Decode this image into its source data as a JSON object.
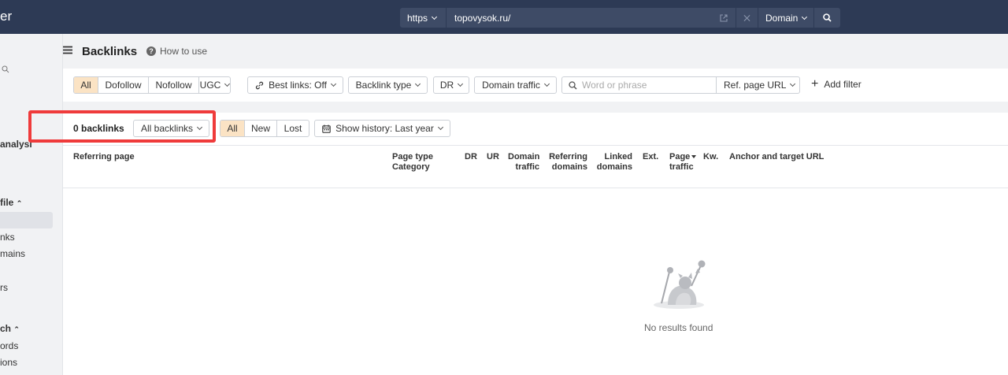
{
  "topbar": {
    "brand": "er",
    "protocol": "https",
    "url": "topovysok.ru/",
    "mode": "Domain"
  },
  "sidebar": {
    "items": [
      {
        "label": "analysi"
      },
      {
        "label": "file"
      },
      {
        "label": "nks"
      },
      {
        "label": "mains"
      },
      {
        "label": "rs"
      },
      {
        "label": "ch"
      },
      {
        "label": "ords"
      },
      {
        "label": "ions"
      }
    ]
  },
  "header": {
    "title": "Backlinks",
    "how_to_use": "How to use"
  },
  "filters": {
    "link_types": [
      "All",
      "Dofollow",
      "Nofollow",
      "UGC"
    ],
    "best_links": "Best links: Off",
    "backlink_type": "Backlink type",
    "dr": "DR",
    "domain_traffic": "Domain traffic",
    "search_placeholder": "Word or phrase",
    "ref_page_url": "Ref. page URL",
    "add_filter": "Add filter"
  },
  "results": {
    "count_label": "0 backlinks",
    "grouping": "All backlinks",
    "status_tabs": [
      "All",
      "New",
      "Lost"
    ],
    "history": "Show history: Last year"
  },
  "table": {
    "columns": {
      "referring_page": "Referring page",
      "page_type_1": "Page type",
      "page_type_2": "Category",
      "dr": "DR",
      "ur": "UR",
      "domain_traffic_1": "Domain",
      "domain_traffic_2": "traffic",
      "referring_domains_1": "Referring",
      "referring_domains_2": "domains",
      "linked_domains_1": "Linked",
      "linked_domains_2": "domains",
      "ext": "Ext.",
      "page_traffic_1": "Page",
      "page_traffic_2": "traffic",
      "kw": "Kw.",
      "anchor": "Anchor and target URL"
    },
    "empty_message": "No results found"
  }
}
